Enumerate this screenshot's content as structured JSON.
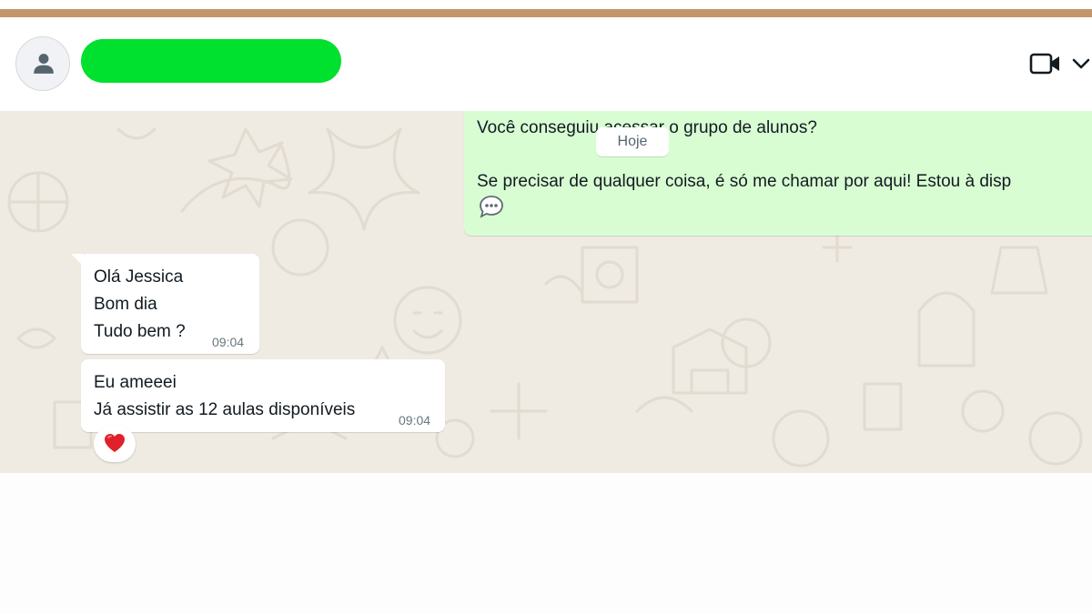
{
  "header": {
    "contact_name_redacted": true,
    "avatar_icon": "person-icon",
    "video_icon": "video-camera-icon",
    "menu_icon": "chevron-down-icon"
  },
  "chat": {
    "date_divider": "Hoje",
    "outgoing": {
      "line1": "Você conseguiu acessar o grupo de alunos?",
      "line2": "Se precisar de qualquer coisa, é só me chamar por aqui! Estou à disp",
      "emoji": "speech-bubble-emoji"
    },
    "incoming": [
      {
        "lines": [
          "Olá Jessica",
          "Bom dia",
          "Tudo bem ?"
        ],
        "time": "09:04"
      },
      {
        "lines": [
          "Eu ameeei",
          "Já assistir as 12 aulas disponíveis"
        ],
        "time": "09:04",
        "reaction": "red-heart"
      }
    ]
  },
  "colors": {
    "frame_border": "#c4956a",
    "redaction": "#00e02e",
    "chat_background": "#efeae2",
    "outgoing_bubble": "#d9fdd3",
    "incoming_bubble": "#ffffff"
  }
}
